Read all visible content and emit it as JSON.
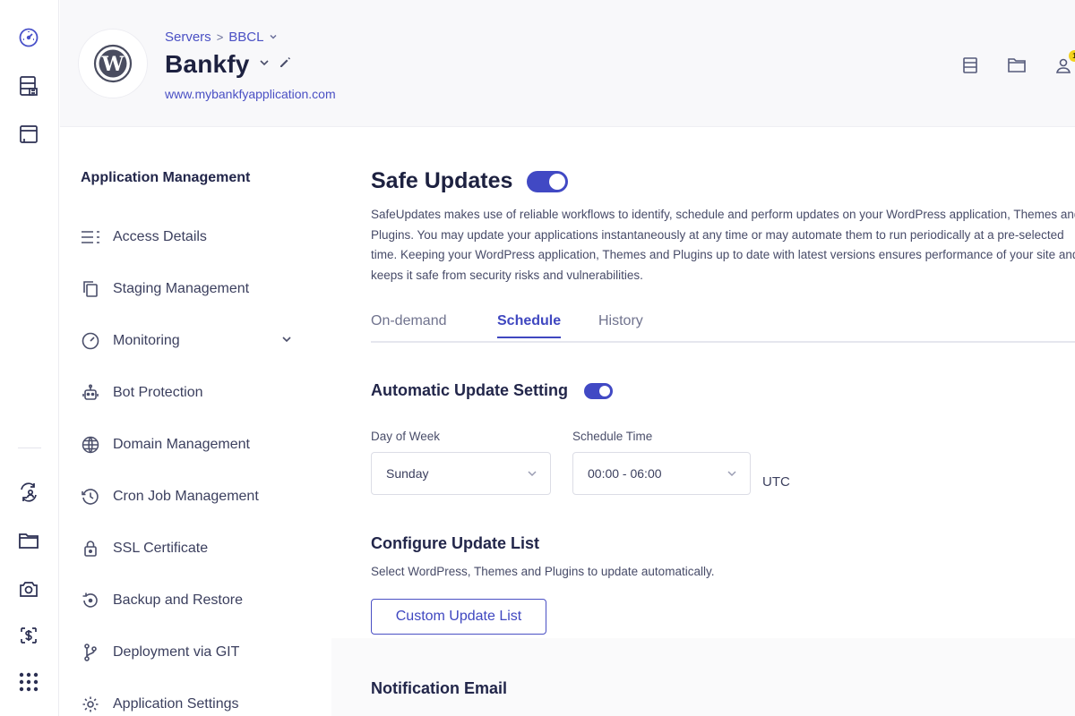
{
  "rail": {
    "top_icons": [
      "speedometer-icon",
      "servers-icon",
      "window-icon"
    ],
    "bottom_icons": [
      "user-sync-icon",
      "folder-icon",
      "settings-gear-icon",
      "billing-icon",
      "apps-grid-icon"
    ]
  },
  "header": {
    "breadcrumb": {
      "root": "Servers",
      "separator": ">",
      "server": "BBCL"
    },
    "app_name": "Bankfy",
    "app_url": "www.mybankfyapplication.com",
    "notification_count": "1"
  },
  "subnav": {
    "title": "Application Management",
    "items": [
      {
        "label": "Access Details",
        "icon": "list-icon"
      },
      {
        "label": "Staging Management",
        "icon": "copy-icon"
      },
      {
        "label": "Monitoring",
        "icon": "gauge-icon"
      },
      {
        "label": "Bot Protection",
        "icon": "robot-icon"
      },
      {
        "label": "Domain Management",
        "icon": "globe-icon"
      },
      {
        "label": "Cron Job Management",
        "icon": "clock-icon"
      },
      {
        "label": "SSL Certificate",
        "icon": "lock-icon"
      },
      {
        "label": "Backup and Restore",
        "icon": "restore-icon"
      },
      {
        "label": "Deployment via GIT",
        "icon": "git-branch-icon"
      },
      {
        "label": "Application Settings",
        "icon": "gear-icon"
      }
    ]
  },
  "main": {
    "title": "Safe Updates",
    "safe_updates_enabled": true,
    "description": "SafeUpdates makes use of reliable workflows to identify, schedule and perform updates on your WordPress application, Themes and Plugins. You may update your applications instantaneously at any time or may automate them to run periodically at a pre-selected time. Keeping your WordPress application, Themes and Plugins up to date with latest versions ensures performance of your site and keeps it safe from security risks and vulnerabilities.",
    "tabs": [
      {
        "label": "On-demand",
        "active": false
      },
      {
        "label": "Schedule",
        "active": true
      },
      {
        "label": "History",
        "active": false
      }
    ],
    "auto_update": {
      "title": "Automatic Update Setting",
      "enabled": true,
      "day_label": "Day of Week",
      "day_value": "Sunday",
      "time_label": "Schedule Time",
      "time_value": "00:00 - 06:00",
      "timezone": "UTC"
    },
    "configure": {
      "title": "Configure Update List",
      "description": "Select WordPress, Themes and Plugins to update automatically.",
      "button": "Custom Update List"
    },
    "notification_title": "Notification Email"
  },
  "colors": {
    "accent": "#4149c4",
    "link": "#4a50c4",
    "text_dark": "#1d2140",
    "notification_badge": "#f3d21c"
  }
}
